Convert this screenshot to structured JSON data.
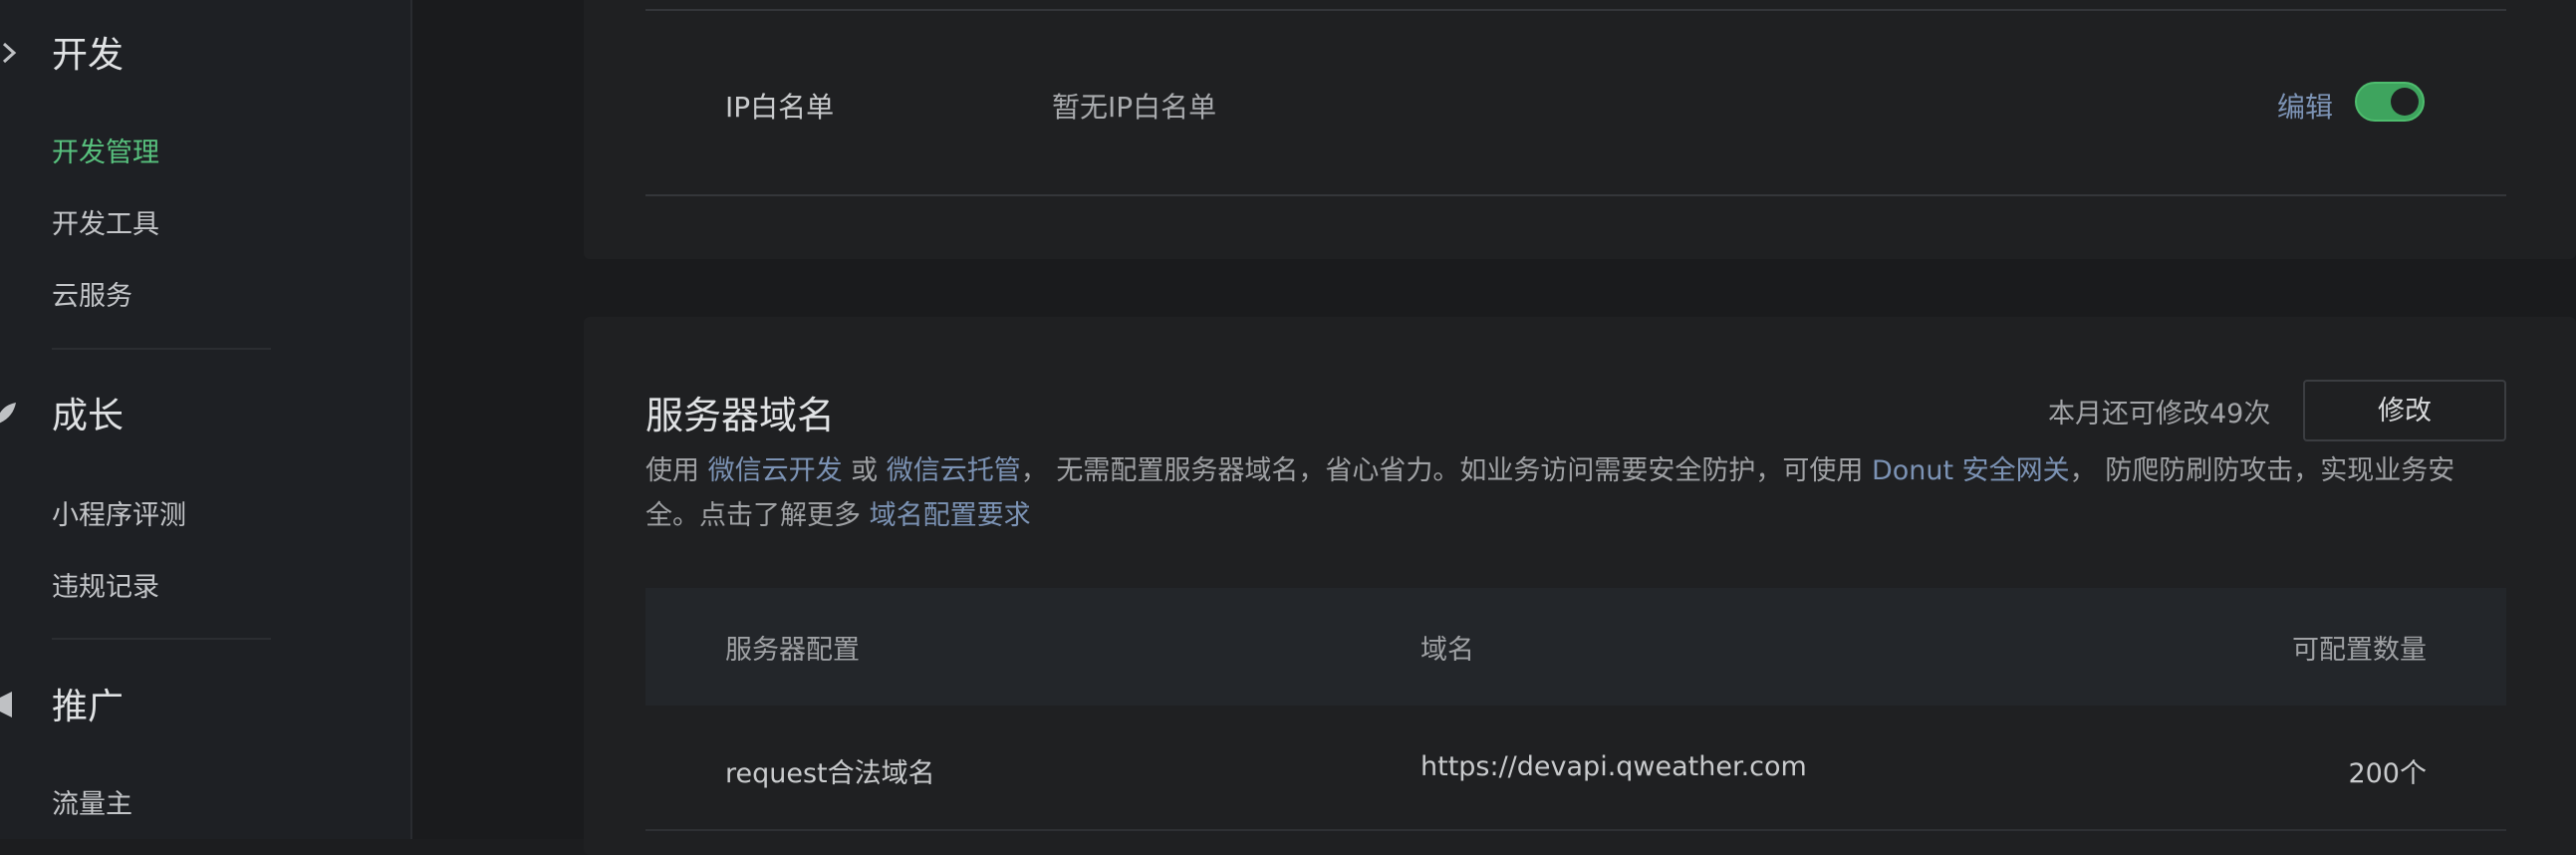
{
  "sidebar": {
    "sections": [
      {
        "title": "开发",
        "icon": "chevron-icon",
        "items": [
          "开发管理",
          "开发工具",
          "云服务"
        ],
        "active": "开发管理"
      },
      {
        "title": "成长",
        "icon": "leaf-icon",
        "items": [
          "小程序评测",
          "违规记录"
        ]
      },
      {
        "title": "推广",
        "icon": "megaphone-icon",
        "items": [
          "流量主"
        ]
      }
    ]
  },
  "ip_whitelist": {
    "label": "IP白名单",
    "value": "暂无IP白名单",
    "edit": "编辑",
    "toggle_on": true
  },
  "server_domain": {
    "title": "服务器域名",
    "quota_text": "本月还可修改49次",
    "modify_button": "修改",
    "desc_parts": [
      "使用 ",
      "微信云开发",
      " 或 ",
      "微信云托管",
      "， 无需配置服务器域名，省心省力。如业务访问需要安全防护，可使用 ",
      "Donut 安全网关",
      "， 防爬防刷防攻击，实现业务安全。点击了解更多 ",
      "域名配置要求"
    ],
    "table": {
      "headers": [
        "服务器配置",
        "域名",
        "可配置数量"
      ],
      "rows": [
        [
          "request合法域名",
          "https://devapi.qweather.com",
          "200个"
        ]
      ]
    }
  },
  "colors": {
    "accent": "#58c27e",
    "link": "#7c93b5",
    "toggle": "#3ea45e"
  }
}
